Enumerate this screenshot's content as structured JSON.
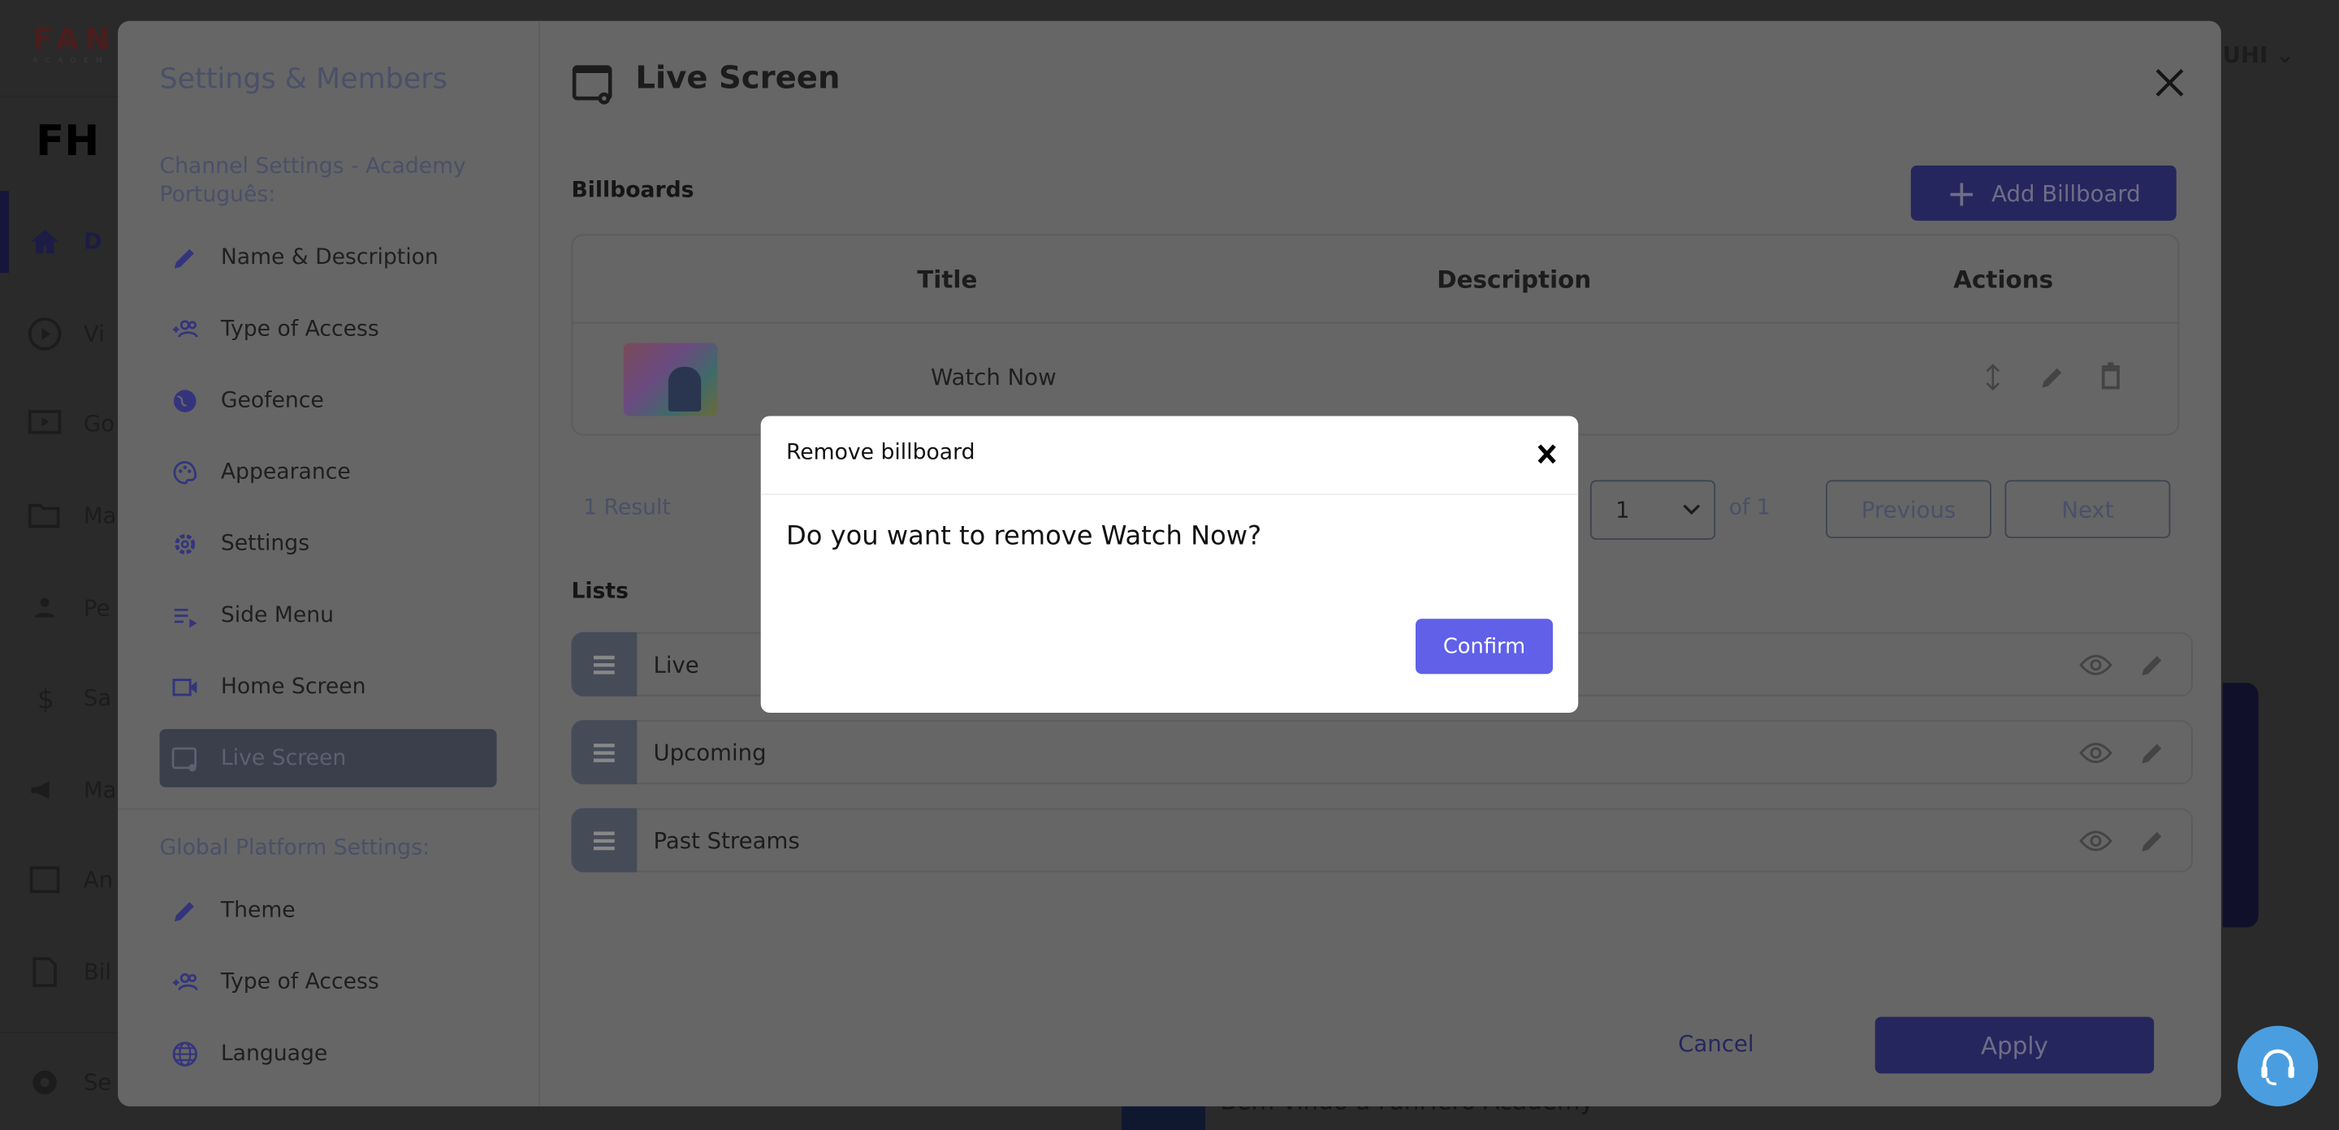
{
  "background": {
    "brand_text": "FANH",
    "brand_sub": "ACADEM",
    "user_label": "UHI",
    "nav_fragments": [
      {
        "icon": "home-icon",
        "label": "D"
      },
      {
        "icon": "play-circle-icon",
        "label": "Vi"
      },
      {
        "icon": "tv-play-icon",
        "label": "Go"
      },
      {
        "icon": "folder-gear-icon",
        "label": "Ma"
      },
      {
        "icon": "people-icon",
        "label": "Pe"
      },
      {
        "icon": "dollar-icon",
        "label": "Sa"
      },
      {
        "icon": "megaphone-icon",
        "label": "Ma"
      },
      {
        "icon": "analytics-icon",
        "label": "An"
      },
      {
        "icon": "billing-icon",
        "label": "Bil"
      },
      {
        "icon": "gear-icon",
        "label": "Se"
      }
    ],
    "card_caption": "Bem-vindo à FanHero Academy"
  },
  "settings": {
    "title": "Settings & Members",
    "channel_heading": "Channel Settings - Academy Português:",
    "channel_items": [
      {
        "label": "Name & Description",
        "icon": "pencil-icon"
      },
      {
        "label": "Type of Access",
        "icon": "add-group-icon"
      },
      {
        "label": "Geofence",
        "icon": "globe-icon"
      },
      {
        "label": "Appearance",
        "icon": "palette-icon"
      },
      {
        "label": "Settings",
        "icon": "gear-icon"
      },
      {
        "label": "Side Menu",
        "icon": "playlist-icon"
      },
      {
        "label": "Home Screen",
        "icon": "video-camera-icon"
      },
      {
        "label": "Live Screen",
        "icon": "screen-gear-icon",
        "active": true
      }
    ],
    "global_heading": "Global Platform Settings:",
    "global_items": [
      {
        "label": "Theme",
        "icon": "pencil-icon"
      },
      {
        "label": "Type of Access",
        "icon": "add-group-icon"
      },
      {
        "label": "Language",
        "icon": "globe-grid-icon"
      }
    ]
  },
  "main": {
    "title": "Live Screen",
    "billboards_label": "Billboards",
    "add_billboard_label": "Add Billboard",
    "table": {
      "columns": [
        "Title",
        "Description",
        "Actions"
      ],
      "rows": [
        {
          "title": "Watch Now",
          "description": ""
        }
      ]
    },
    "pagination": {
      "result_count": "1 Result",
      "page": "1",
      "of_label": "of 1",
      "previous_label": "Previous",
      "next_label": "Next"
    },
    "lists_label": "Lists",
    "lists": [
      {
        "label": "Live"
      },
      {
        "label": "Upcoming"
      },
      {
        "label": "Past Streams"
      }
    ],
    "cancel_label": "Cancel",
    "apply_label": "Apply"
  },
  "dialog": {
    "title": "Remove billboard",
    "message": "Do you want to remove Watch Now?",
    "confirm_label": "Confirm"
  },
  "colors": {
    "accent": "#6060e8",
    "primary_dimmed": "#26265e",
    "help_bubble": "#4a9ee0"
  }
}
